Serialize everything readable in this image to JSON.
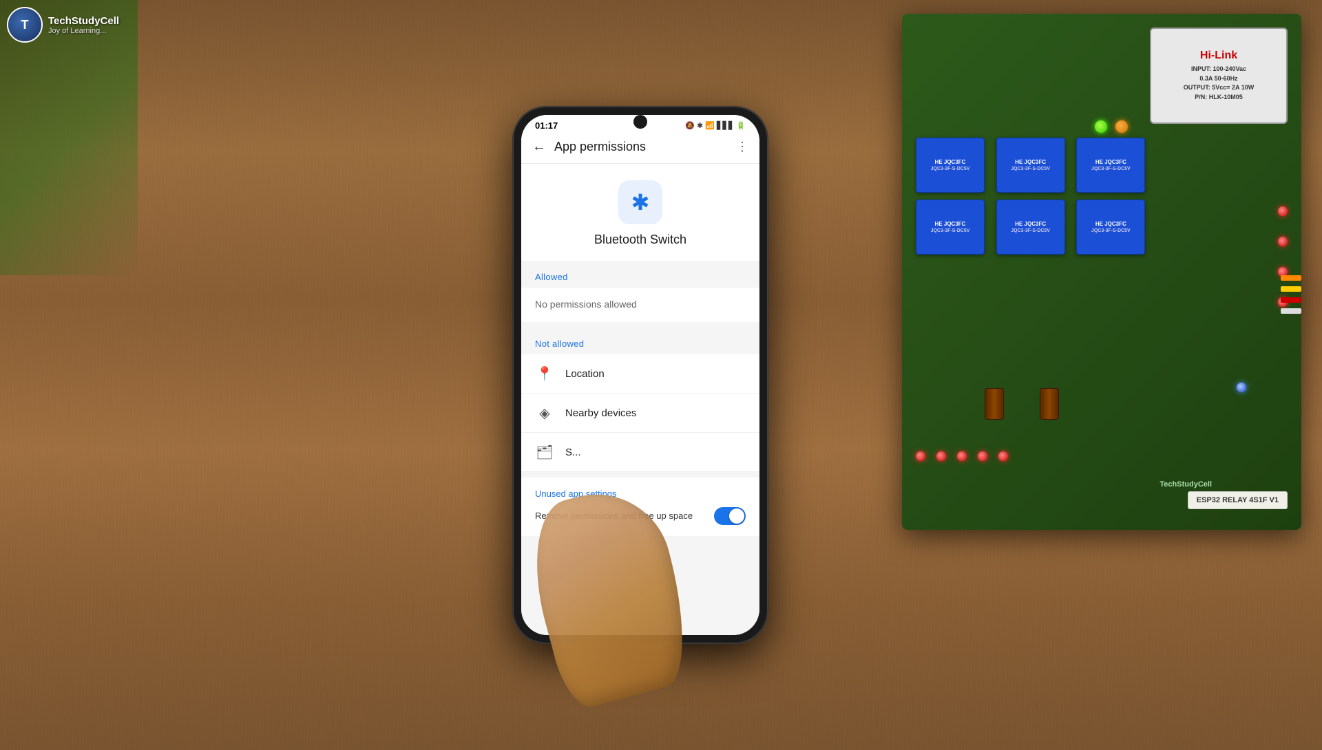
{
  "channel": {
    "name": "TechStudyCell",
    "subtitle": "Joy of Learning...",
    "avatar_letter": "T"
  },
  "status_bar": {
    "time": "01:17",
    "icons": "🔕 ✱ 📶 📶 🔋"
  },
  "app_bar": {
    "title": "App permissions",
    "back_label": "←",
    "more_label": "⋮"
  },
  "app": {
    "name": "Bluetooth Switch",
    "icon": "bluetooth"
  },
  "permissions": {
    "allowed_header": "Allowed",
    "allowed_empty": "No permissions allowed",
    "not_allowed_header": "Not allowed",
    "items": [
      {
        "icon": "📍",
        "label": "Location"
      },
      {
        "icon": "◈",
        "label": "Nearby devices"
      },
      {
        "icon": "🗂",
        "label": "Storage"
      }
    ],
    "unused_header": "Unused app settings",
    "toggle_text": "Remove permissions and free up space",
    "toggle_state": "on"
  },
  "relay_modules": [
    {
      "label": "HE JQC3FC",
      "sublabel": "JQC3-3F-S-DC5V"
    },
    {
      "label": "HE JQC3FC",
      "sublabel": "JQC3-3F-S-DC5V"
    },
    {
      "label": "HE JQC3FC",
      "sublabel": "JQC3-3F-S-DC5V"
    },
    {
      "label": "HE JQC3FC",
      "sublabel": "JQC3-3F-S-DC5V"
    },
    {
      "label": "HE JQC3FC",
      "sublabel": "JQC3-3F-S-DC5V"
    },
    {
      "label": "HE JQC3FC",
      "sublabel": "JQC3-3F-S-DC5V"
    }
  ],
  "esp32_label": "ESP32 RELAY 4S1F V1",
  "studycell_label": "TechStudyCell"
}
